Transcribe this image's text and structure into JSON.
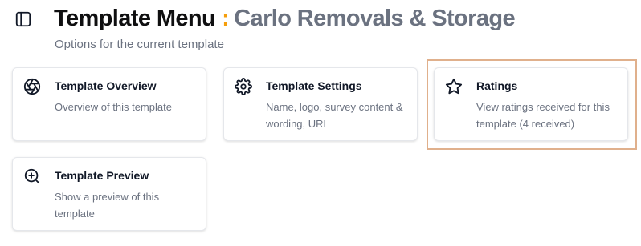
{
  "header": {
    "title_main": "Template Menu",
    "title_separator": ":",
    "title_sub": "Carlo Removals & Storage",
    "subtitle": "Options for the current template",
    "separator_color": "#f59e0b"
  },
  "cards": [
    {
      "icon": "aperture-icon",
      "title": "Template Overview",
      "description": "Overview of this template"
    },
    {
      "icon": "gear-icon",
      "title": "Template Settings",
      "description": "Name, logo, survey content & wording, URL"
    },
    {
      "icon": "star-icon",
      "title": "Ratings",
      "description": "View ratings received for this template (4 received)",
      "highlighted": true,
      "highlight_color": "#e0b08c"
    },
    {
      "icon": "zoom-in-icon",
      "title": "Template Preview",
      "description": "Show a preview of this template"
    }
  ]
}
